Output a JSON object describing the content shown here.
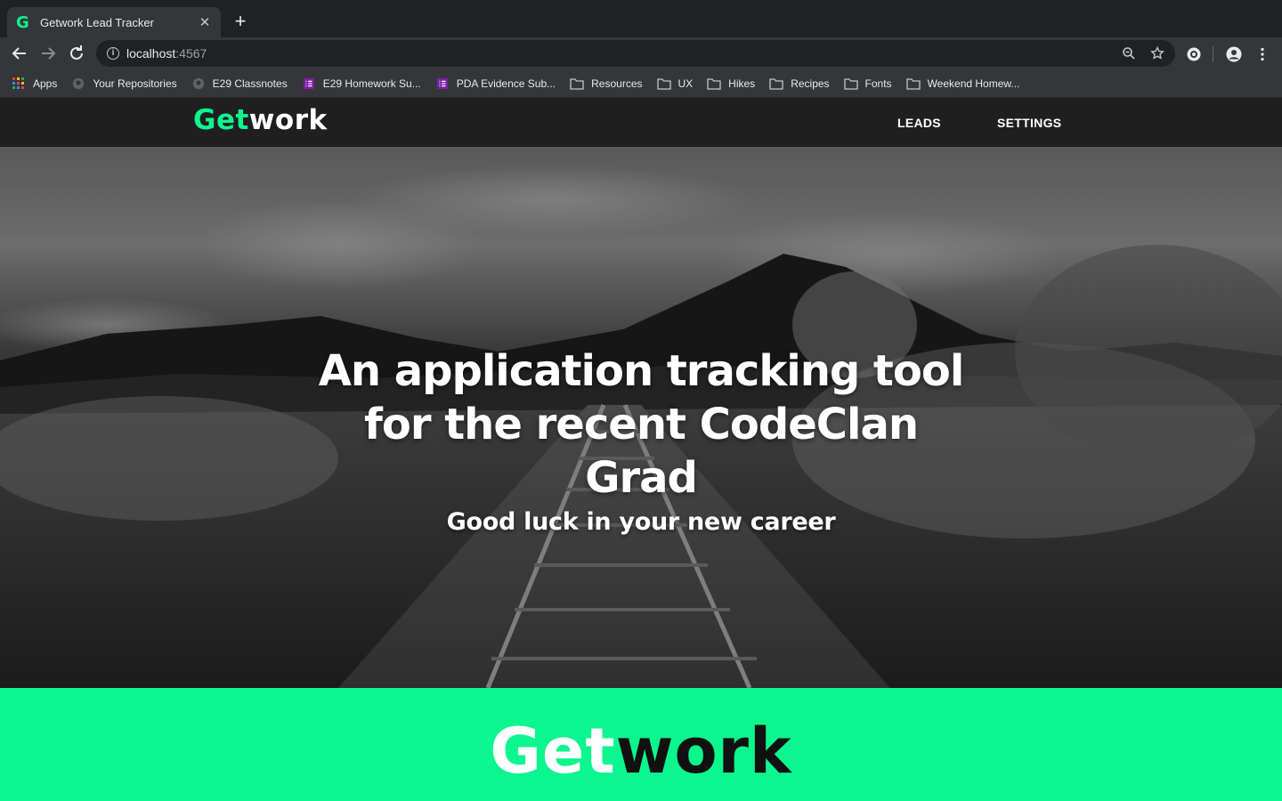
{
  "browser": {
    "tab": {
      "title": "Getwork Lead Tracker",
      "favicon": "G"
    },
    "address": {
      "host": "localhost",
      "port": ":4567"
    },
    "bookmarks": [
      {
        "label": "Apps",
        "icon": "apps-grid-icon"
      },
      {
        "label": "Your Repositories",
        "icon": "github-icon"
      },
      {
        "label": "E29 Classnotes",
        "icon": "github-icon"
      },
      {
        "label": "E29 Homework Su...",
        "icon": "form-list-icon"
      },
      {
        "label": "PDA Evidence Sub...",
        "icon": "form-list-icon"
      },
      {
        "label": "Resources",
        "icon": "folder-icon"
      },
      {
        "label": "UX",
        "icon": "folder-icon"
      },
      {
        "label": "Hikes",
        "icon": "folder-icon"
      },
      {
        "label": "Recipes",
        "icon": "folder-icon"
      },
      {
        "label": "Fonts",
        "icon": "folder-icon"
      },
      {
        "label": "Weekend Homew...",
        "icon": "folder-icon"
      }
    ]
  },
  "site": {
    "logo": {
      "part1": "Get",
      "part2": "work"
    },
    "nav": {
      "leads": "LEADS",
      "settings": "SETTINGS"
    },
    "hero": {
      "headline": "An application tracking tool for the recent CodeClan Grad",
      "subheadline": "Good luck in your new career"
    },
    "footer_logo": {
      "part1": "Get",
      "part2": "work"
    }
  },
  "colors": {
    "brand_green": "#0cf58e",
    "nav_bg": "#1f1f20",
    "chrome_bg": "#35363a"
  }
}
